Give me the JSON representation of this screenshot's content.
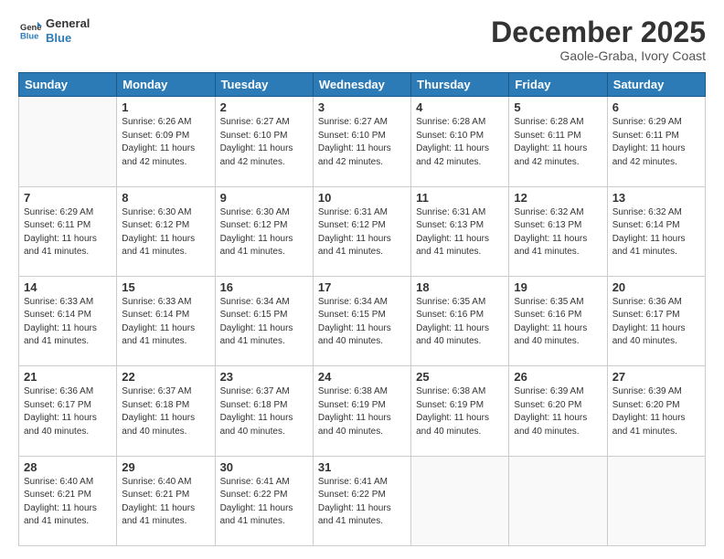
{
  "header": {
    "logo_general": "General",
    "logo_blue": "Blue",
    "month_title": "December 2025",
    "location": "Gaole-Graba, Ivory Coast"
  },
  "weekdays": [
    "Sunday",
    "Monday",
    "Tuesday",
    "Wednesday",
    "Thursday",
    "Friday",
    "Saturday"
  ],
  "rows": [
    [
      {
        "day": "",
        "sunrise": "",
        "sunset": "",
        "daylight": ""
      },
      {
        "day": "1",
        "sunrise": "Sunrise: 6:26 AM",
        "sunset": "Sunset: 6:09 PM",
        "daylight": "Daylight: 11 hours and 42 minutes."
      },
      {
        "day": "2",
        "sunrise": "Sunrise: 6:27 AM",
        "sunset": "Sunset: 6:10 PM",
        "daylight": "Daylight: 11 hours and 42 minutes."
      },
      {
        "day": "3",
        "sunrise": "Sunrise: 6:27 AM",
        "sunset": "Sunset: 6:10 PM",
        "daylight": "Daylight: 11 hours and 42 minutes."
      },
      {
        "day": "4",
        "sunrise": "Sunrise: 6:28 AM",
        "sunset": "Sunset: 6:10 PM",
        "daylight": "Daylight: 11 hours and 42 minutes."
      },
      {
        "day": "5",
        "sunrise": "Sunrise: 6:28 AM",
        "sunset": "Sunset: 6:11 PM",
        "daylight": "Daylight: 11 hours and 42 minutes."
      },
      {
        "day": "6",
        "sunrise": "Sunrise: 6:29 AM",
        "sunset": "Sunset: 6:11 PM",
        "daylight": "Daylight: 11 hours and 42 minutes."
      }
    ],
    [
      {
        "day": "7",
        "sunrise": "Sunrise: 6:29 AM",
        "sunset": "Sunset: 6:11 PM",
        "daylight": "Daylight: 11 hours and 41 minutes."
      },
      {
        "day": "8",
        "sunrise": "Sunrise: 6:30 AM",
        "sunset": "Sunset: 6:12 PM",
        "daylight": "Daylight: 11 hours and 41 minutes."
      },
      {
        "day": "9",
        "sunrise": "Sunrise: 6:30 AM",
        "sunset": "Sunset: 6:12 PM",
        "daylight": "Daylight: 11 hours and 41 minutes."
      },
      {
        "day": "10",
        "sunrise": "Sunrise: 6:31 AM",
        "sunset": "Sunset: 6:12 PM",
        "daylight": "Daylight: 11 hours and 41 minutes."
      },
      {
        "day": "11",
        "sunrise": "Sunrise: 6:31 AM",
        "sunset": "Sunset: 6:13 PM",
        "daylight": "Daylight: 11 hours and 41 minutes."
      },
      {
        "day": "12",
        "sunrise": "Sunrise: 6:32 AM",
        "sunset": "Sunset: 6:13 PM",
        "daylight": "Daylight: 11 hours and 41 minutes."
      },
      {
        "day": "13",
        "sunrise": "Sunrise: 6:32 AM",
        "sunset": "Sunset: 6:14 PM",
        "daylight": "Daylight: 11 hours and 41 minutes."
      }
    ],
    [
      {
        "day": "14",
        "sunrise": "Sunrise: 6:33 AM",
        "sunset": "Sunset: 6:14 PM",
        "daylight": "Daylight: 11 hours and 41 minutes."
      },
      {
        "day": "15",
        "sunrise": "Sunrise: 6:33 AM",
        "sunset": "Sunset: 6:14 PM",
        "daylight": "Daylight: 11 hours and 41 minutes."
      },
      {
        "day": "16",
        "sunrise": "Sunrise: 6:34 AM",
        "sunset": "Sunset: 6:15 PM",
        "daylight": "Daylight: 11 hours and 41 minutes."
      },
      {
        "day": "17",
        "sunrise": "Sunrise: 6:34 AM",
        "sunset": "Sunset: 6:15 PM",
        "daylight": "Daylight: 11 hours and 40 minutes."
      },
      {
        "day": "18",
        "sunrise": "Sunrise: 6:35 AM",
        "sunset": "Sunset: 6:16 PM",
        "daylight": "Daylight: 11 hours and 40 minutes."
      },
      {
        "day": "19",
        "sunrise": "Sunrise: 6:35 AM",
        "sunset": "Sunset: 6:16 PM",
        "daylight": "Daylight: 11 hours and 40 minutes."
      },
      {
        "day": "20",
        "sunrise": "Sunrise: 6:36 AM",
        "sunset": "Sunset: 6:17 PM",
        "daylight": "Daylight: 11 hours and 40 minutes."
      }
    ],
    [
      {
        "day": "21",
        "sunrise": "Sunrise: 6:36 AM",
        "sunset": "Sunset: 6:17 PM",
        "daylight": "Daylight: 11 hours and 40 minutes."
      },
      {
        "day": "22",
        "sunrise": "Sunrise: 6:37 AM",
        "sunset": "Sunset: 6:18 PM",
        "daylight": "Daylight: 11 hours and 40 minutes."
      },
      {
        "day": "23",
        "sunrise": "Sunrise: 6:37 AM",
        "sunset": "Sunset: 6:18 PM",
        "daylight": "Daylight: 11 hours and 40 minutes."
      },
      {
        "day": "24",
        "sunrise": "Sunrise: 6:38 AM",
        "sunset": "Sunset: 6:19 PM",
        "daylight": "Daylight: 11 hours and 40 minutes."
      },
      {
        "day": "25",
        "sunrise": "Sunrise: 6:38 AM",
        "sunset": "Sunset: 6:19 PM",
        "daylight": "Daylight: 11 hours and 40 minutes."
      },
      {
        "day": "26",
        "sunrise": "Sunrise: 6:39 AM",
        "sunset": "Sunset: 6:20 PM",
        "daylight": "Daylight: 11 hours and 40 minutes."
      },
      {
        "day": "27",
        "sunrise": "Sunrise: 6:39 AM",
        "sunset": "Sunset: 6:20 PM",
        "daylight": "Daylight: 11 hours and 41 minutes."
      }
    ],
    [
      {
        "day": "28",
        "sunrise": "Sunrise: 6:40 AM",
        "sunset": "Sunset: 6:21 PM",
        "daylight": "Daylight: 11 hours and 41 minutes."
      },
      {
        "day": "29",
        "sunrise": "Sunrise: 6:40 AM",
        "sunset": "Sunset: 6:21 PM",
        "daylight": "Daylight: 11 hours and 41 minutes."
      },
      {
        "day": "30",
        "sunrise": "Sunrise: 6:41 AM",
        "sunset": "Sunset: 6:22 PM",
        "daylight": "Daylight: 11 hours and 41 minutes."
      },
      {
        "day": "31",
        "sunrise": "Sunrise: 6:41 AM",
        "sunset": "Sunset: 6:22 PM",
        "daylight": "Daylight: 11 hours and 41 minutes."
      },
      {
        "day": "",
        "sunrise": "",
        "sunset": "",
        "daylight": ""
      },
      {
        "day": "",
        "sunrise": "",
        "sunset": "",
        "daylight": ""
      },
      {
        "day": "",
        "sunrise": "",
        "sunset": "",
        "daylight": ""
      }
    ]
  ]
}
